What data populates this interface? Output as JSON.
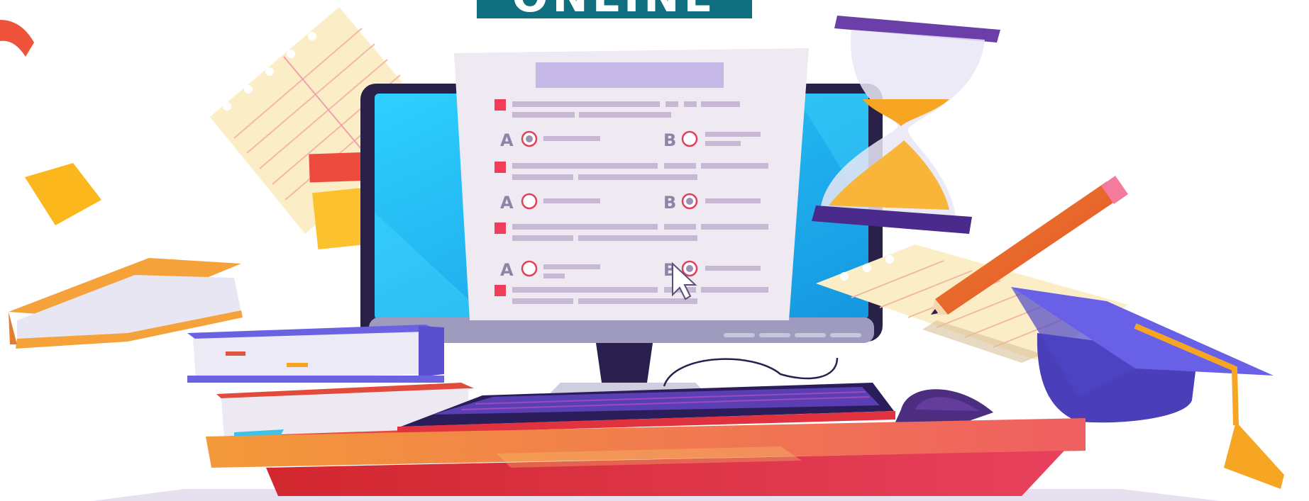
{
  "banner": {
    "text": "ONLINE"
  },
  "quiz": {
    "questions": [
      {
        "options": [
          {
            "letter": "A",
            "selected": true
          },
          {
            "letter": "B",
            "selected": false
          }
        ]
      },
      {
        "options": [
          {
            "letter": "A",
            "selected": false
          },
          {
            "letter": "B",
            "selected": true
          }
        ]
      },
      {
        "options": [
          {
            "letter": "A",
            "selected": false
          },
          {
            "letter": "B",
            "selected": true
          }
        ]
      }
    ]
  },
  "colors": {
    "banner": "#0f6f7f",
    "screen": "#1fb6ee",
    "paper": "#efe9f2",
    "placeholder_line": "#c7b9d3",
    "question_marker": "#ef3d5a",
    "radio": "#e2415a",
    "desk_top": "#f08a3c",
    "desk_front": "#e0353f",
    "grad_cap": "#5b55d6",
    "sand": "#f7a623"
  },
  "icons": [
    "cursor-arrow-icon",
    "hourglass-icon",
    "pencil-icon",
    "graduation-cap-icon",
    "book-icon"
  ]
}
